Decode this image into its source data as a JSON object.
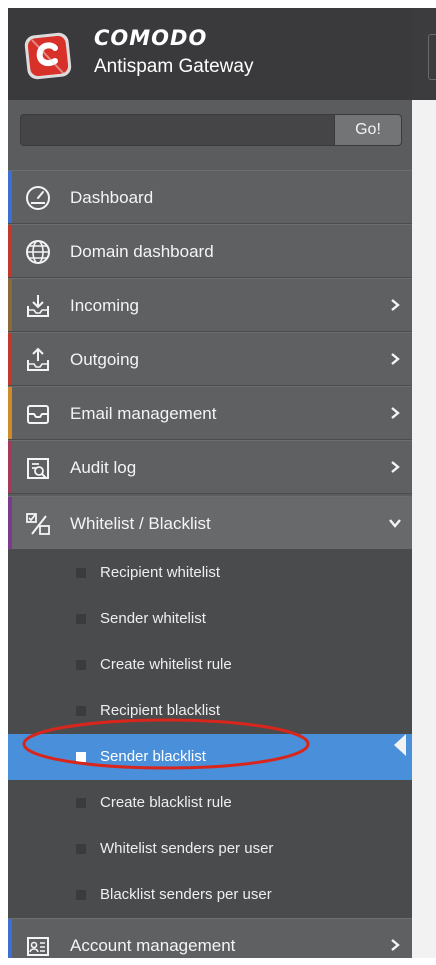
{
  "brand": {
    "name": "COMODO",
    "subtitle": "Antispam Gateway"
  },
  "search": {
    "placeholder": "",
    "value": "",
    "button_label": "Go!"
  },
  "menu": [
    {
      "label": "Dashboard",
      "icon": "dashboard-icon",
      "accent": "#3d6fd1",
      "has_chevron": false
    },
    {
      "label": "Domain dashboard",
      "icon": "globe-icon",
      "accent": "#c0392b",
      "has_chevron": false
    },
    {
      "label": "Incoming",
      "icon": "inbox-download-icon",
      "accent": "#8a6a3a",
      "has_chevron": true
    },
    {
      "label": "Outgoing",
      "icon": "outbox-upload-icon",
      "accent": "#c0392b",
      "has_chevron": true
    },
    {
      "label": "Email management",
      "icon": "email-tray-icon",
      "accent": "#d08a2c",
      "has_chevron": true
    },
    {
      "label": "Audit log",
      "icon": "audit-log-icon",
      "accent": "#a33a5a",
      "has_chevron": true
    },
    {
      "label": "Whitelist / Blacklist",
      "icon": "whitelist-blacklist-icon",
      "accent": "#7a3b8f",
      "has_chevron": true,
      "expanded": true
    }
  ],
  "submenu": [
    {
      "label": "Recipient whitelist",
      "active": false
    },
    {
      "label": "Sender whitelist",
      "active": false
    },
    {
      "label": "Create whitelist rule",
      "active": false
    },
    {
      "label": "Recipient blacklist",
      "active": false
    },
    {
      "label": "Sender blacklist",
      "active": true
    },
    {
      "label": "Create blacklist rule",
      "active": false
    },
    {
      "label": "Whitelist senders per user",
      "active": false
    },
    {
      "label": "Blacklist senders per user",
      "active": false
    }
  ],
  "bottom_menu": {
    "label": "Account management",
    "icon": "account-card-icon",
    "accent": "#3d6fd1",
    "has_chevron": true
  },
  "colors": {
    "sidebar_bg": "#5b5c5e",
    "header_bg": "#3a3a3c",
    "submenu_bg": "#4a4b4d",
    "active_item": "#4a8fd9",
    "highlight_ring": "#d9261c"
  }
}
